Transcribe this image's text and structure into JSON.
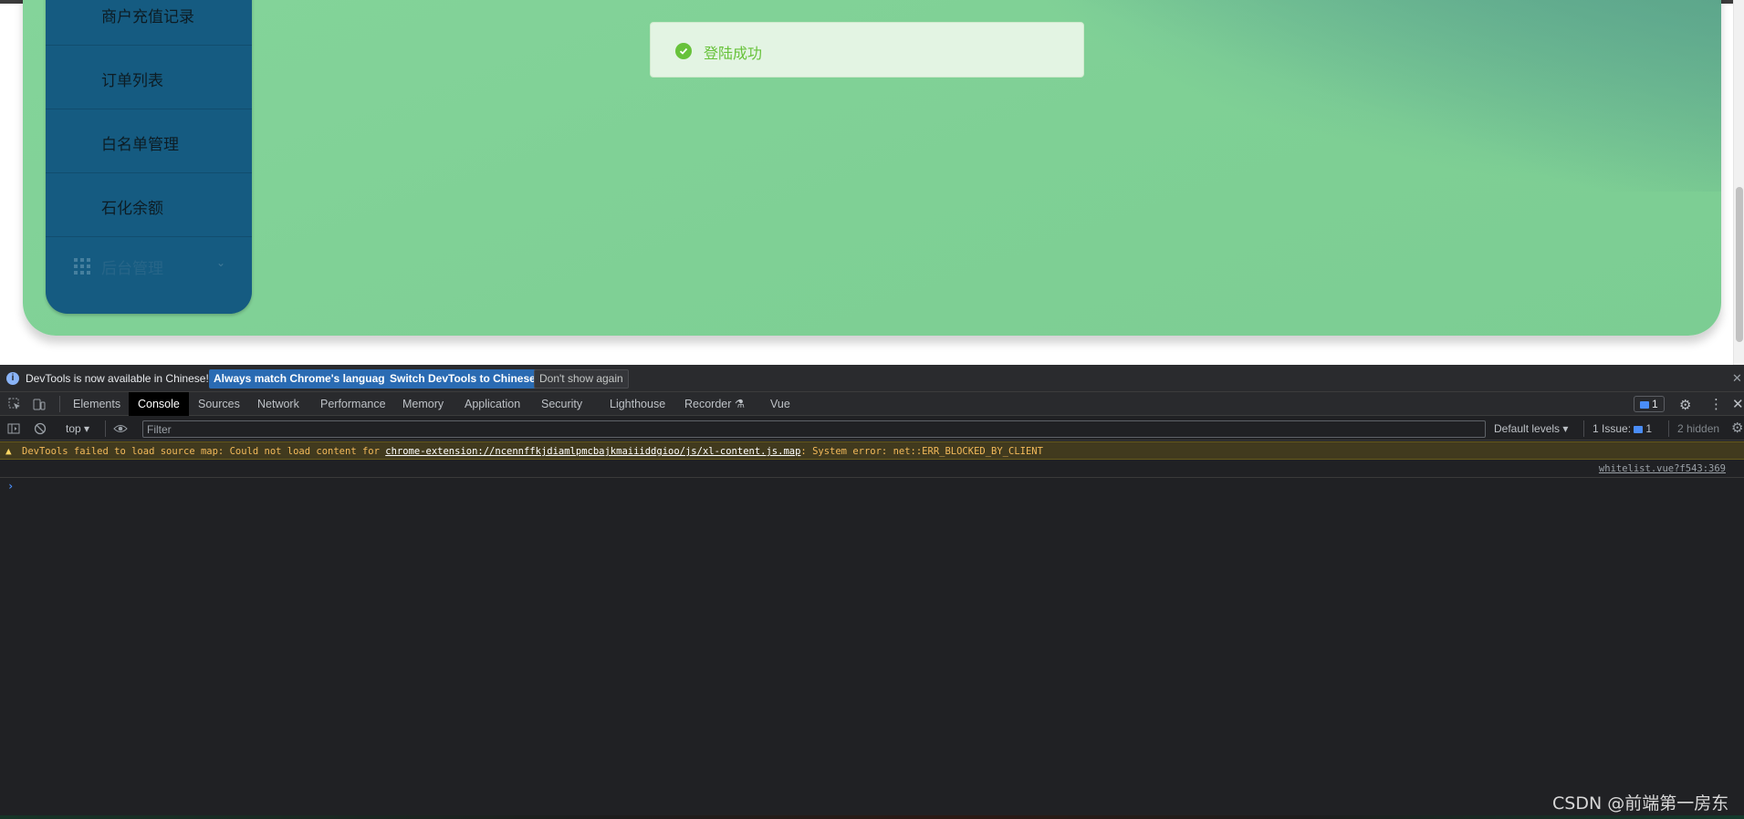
{
  "page": {
    "sidebar": {
      "items": [
        {
          "label": "商户充值记录"
        },
        {
          "label": "订单列表"
        },
        {
          "label": "白名单管理"
        },
        {
          "label": "石化余额"
        }
      ],
      "group": {
        "label": "后台管理",
        "icon": "grid-icon"
      }
    },
    "toast": {
      "message": "登陆成功",
      "type": "success",
      "icon": "check-circle-icon"
    },
    "colors": {
      "background": "#7ccd93",
      "sidebar": "#155b81",
      "toast_text": "#67c23a"
    }
  },
  "devtools": {
    "infobar": {
      "message": "DevTools is now available in Chinese!",
      "buttons": [
        "Always match Chrome's language",
        "Switch DevTools to Chinese",
        "Don't show again"
      ]
    },
    "tabs": [
      {
        "label": "Elements"
      },
      {
        "label": "Console",
        "active": true
      },
      {
        "label": "Sources"
      },
      {
        "label": "Network"
      },
      {
        "label": "Performance"
      },
      {
        "label": "Memory"
      },
      {
        "label": "Application"
      },
      {
        "label": "Security"
      },
      {
        "label": "Lighthouse"
      },
      {
        "label": "Recorder ⚗"
      },
      {
        "label": "Vue"
      }
    ],
    "issue_count": "1",
    "filterbar": {
      "context": "top ▾",
      "filter_placeholder": "Filter",
      "levels": "Default levels ▾",
      "issues_label": "1 Issue:",
      "issues_count": "1",
      "hidden": "2 hidden"
    },
    "console": {
      "warning": {
        "prefix": "DevTools failed to load source map: Could not load content for ",
        "link": "chrome-extension://ncennffkjdiamlpmcbajkmaiiiddgioo/js/xl-content.js.map",
        "suffix": ": System error: net::ERR_BLOCKED_BY_CLIENT"
      },
      "log_source": "whitelist.vue?f543:369",
      "prompt": "›"
    }
  },
  "watermark": "CSDN @前端第一房东"
}
